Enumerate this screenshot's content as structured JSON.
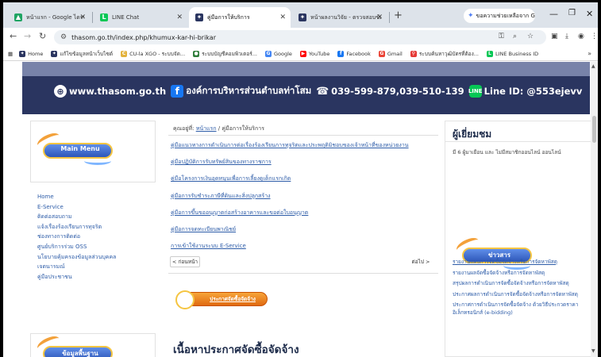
{
  "browser": {
    "tabs": [
      {
        "label": "หน้าแรก - Google ไดรฟ์",
        "icon": "google-drive-icon"
      },
      {
        "label": "LINE Chat",
        "icon": "line-icon"
      },
      {
        "label": "คู่มือการให้บริการ",
        "icon": "site-logo-icon"
      },
      {
        "label": "หน้าผลงานวิจัย - ตรวจสอบข้อมูล",
        "icon": "site-logo-icon"
      }
    ],
    "new_tab": "+",
    "gemini_chip": "ขอความช่วยเหลือจาก Gemini",
    "url": "thasom.go.th/index.php/khumux-kar-hi-brikar",
    "bookmarks": [
      "Home",
      "แก้ไขข้อมูลหน้าเว็บไซต์",
      "CU-la XGO - ระบบจัด...",
      "ระบบบัญชีคอมพิวเตอร์...",
      "Google",
      "YouTube",
      "Facebook",
      "Gmail",
      "ระบบค้นหาวุฒิบัตรที่ต้อง...",
      "LINE Business ID"
    ],
    "bookmarks_more": "»"
  },
  "banner": {
    "website": "www.thasom.go.th",
    "org_name": "องค์การบริหารส่วนตำบลท่าโสม",
    "phone": "039-599-879,039-510-139",
    "line_id": "Line ID: @553ejevv"
  },
  "left_sidebar": {
    "main_menu_label": "Main Menu",
    "menu_items": [
      "Home",
      "E-Service",
      "ติดต่อสอบถาม",
      "แจ้งเรื่องร้องเรียนการทุจริต",
      "ช่องทางการติดต่อ",
      "ศูนย์บริการร่วม OSS",
      "นโยบายคุ้มครองข้อมูลส่วนบุคคล",
      "เจตนารมณ์",
      "คู่มือประชาชน"
    ],
    "basic_info_label": "ข้อมูลพื้นฐาน"
  },
  "main": {
    "breadcrumb_prefix": "คุณอยู่ที่:",
    "breadcrumb_home": "หน้าแรก",
    "breadcrumb_separator": "/",
    "breadcrumb_current": "คู่มือการให้บริการ",
    "documents": [
      "คู่มือแนวทางการดำเนินการต่อเรื่องร้องเรียนการทุจริตและประพฤติมิชอบของเจ้าหน้าที่ของหน่วยงาน",
      "คู่มือปฏิบัติการรับทรัพย์สินของทางราชการ",
      "คู่มือโครงการเงินอุดหนุนเพื่อการเลี้ยงดูเด็กแรกเกิด",
      "คู่มือการรับชำระภาษีที่ดินและสิ่งปลูกสร้าง",
      "คู่มือการขึ้นขออนุญาตก่อสร้างอาคารและขอต่อใบอนุญาต",
      "คู่มือการจดทะเบียนพาณิชย์",
      "การเข้าใช้งานระบบ E-Service"
    ],
    "prev_label": "< ก่อนหน้า",
    "next_label": "ต่อไป >",
    "procurement_banner": "ประกาศจัดซื้อจัดจ้าง",
    "content_heading": "เนื้อหาประกาศจัดซื้อจัดจ้าง"
  },
  "right_sidebar": {
    "visitor_title": "ผู้เยี่ยมชม",
    "visitor_text": "มี 6 ผู้มาเยือน และ ไม่มีสมาชิกออนไลน์ ออนไลน์",
    "news_label": "ข่าวสาร",
    "links": [
      "รายงานแผนการจัดซื้อจัดจ้างหรือการจัดหาพัสดุ",
      "รายงานผลจัดซื้อจัดจ้างหรือการจัดหาพัสดุ",
      "สรุปผลการดำเนินการจัดซื้อจัดจ้างหรือการจัดหาพัสดุ",
      "ประกาศผลการดำเนินการจัดซื้อจัดจ้างหรือการจัดหาพัสดุ",
      "ประกาศการดำเนินการจัดซื้อจัดจ้าง ด้วยวิธีประกวดราคาอิเล็กทรอนิกส์ (e-bidding)"
    ]
  },
  "colors": {
    "banner_bg": "#2a3560",
    "link": "#2d5ca8",
    "heading": "#1d2b4a",
    "menu_pill": "#2d56b8",
    "proc_pill": "#e06a10"
  }
}
